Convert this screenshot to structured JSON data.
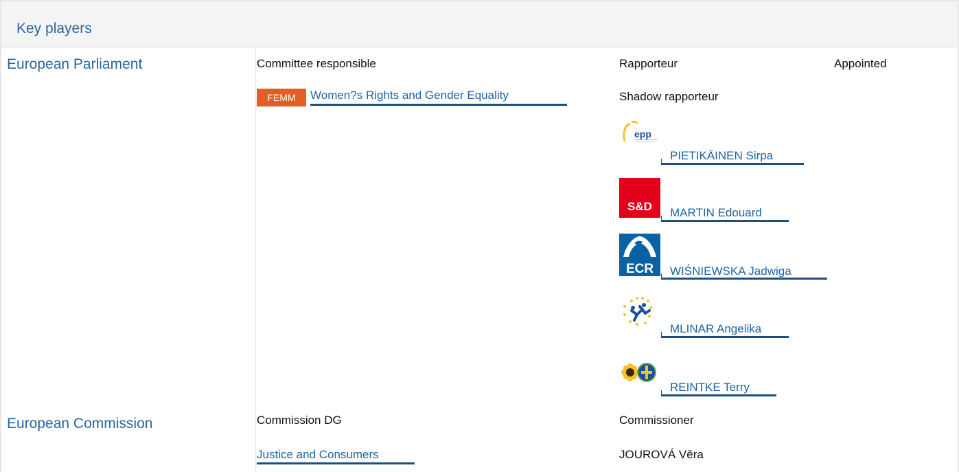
{
  "panel": {
    "title": "Key players"
  },
  "parliament": {
    "label": "European Parliament",
    "committee_header": "Committee responsible",
    "rapporteur_header": "Rapporteur",
    "appointed_header": "Appointed",
    "committee": {
      "code": "FEMM",
      "name": "Women?s Rights and Gender Equality"
    },
    "shadow_header": "Shadow rapporteur",
    "shadows": [
      {
        "name": "PIETIKÄINEN Sirpa",
        "group_icon": "epp-logo-icon",
        "group_text": "epp"
      },
      {
        "name": "MARTIN Edouard",
        "group_icon": "sd-logo-icon",
        "group_text": "S&D"
      },
      {
        "name": "WIŚNIEWSKA Jadwiga",
        "group_icon": "ecr-logo-icon",
        "group_text": "ECR"
      },
      {
        "name": "MLINAR Angelika",
        "group_icon": "alde-logo-icon",
        "group_text": ""
      },
      {
        "name": "REINTKE Terry",
        "group_icon": "greens-efa-logo-icon",
        "group_text": ""
      }
    ]
  },
  "commission": {
    "label": "European Commission",
    "dg_header": "Commission DG",
    "commissioner_header": "Commissioner",
    "dg": "Justice and Consumers",
    "commissioner": "JOUROVÁ Věra"
  },
  "colors": {
    "link": "#1d64a6",
    "heading": "#2667a0",
    "femm_badge": "#e25e25",
    "sd_red": "#e3001b",
    "ecr_blue": "#0a62a5"
  }
}
